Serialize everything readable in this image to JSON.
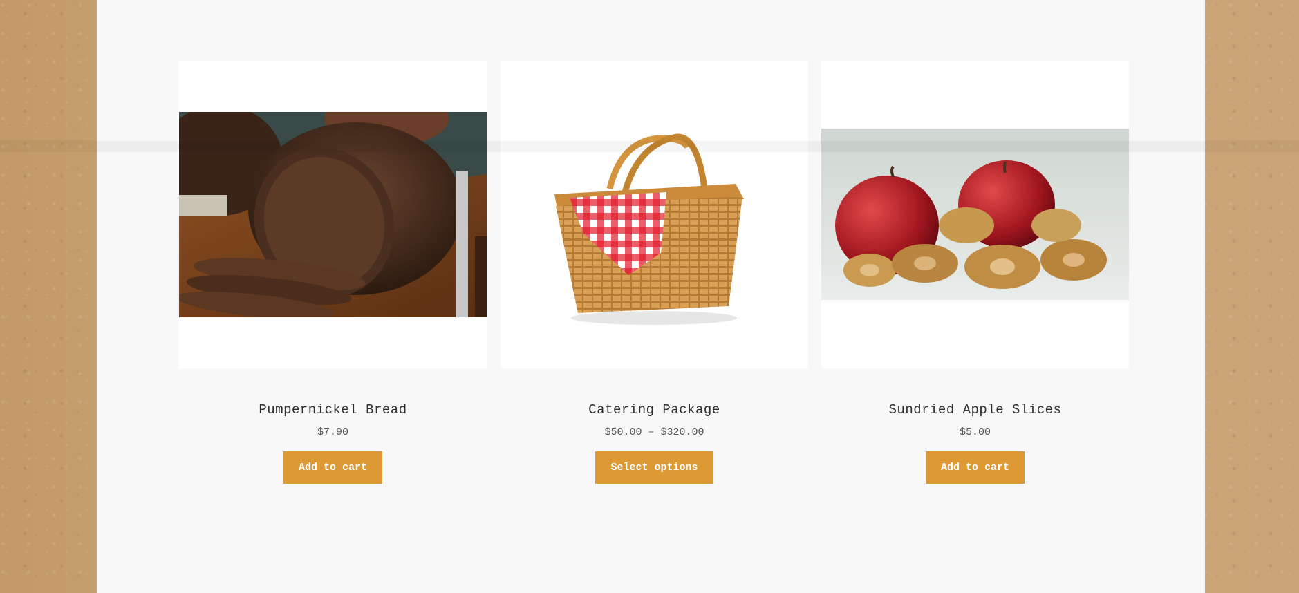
{
  "colors": {
    "accent": "#dd9933",
    "page_background": "#f8f8f8",
    "card_background": "#ffffff"
  },
  "products": [
    {
      "name": "Pumpernickel Bread",
      "price": "$7.90",
      "button_label": "Add to cart",
      "image": "pumpernickel-bread-image"
    },
    {
      "name": "Catering Package",
      "price": "$50.00 – $320.00",
      "button_label": "Select options",
      "image": "picnic-basket-image"
    },
    {
      "name": "Sundried Apple Slices",
      "price": "$5.00",
      "button_label": "Add to cart",
      "image": "apple-slices-image"
    }
  ]
}
